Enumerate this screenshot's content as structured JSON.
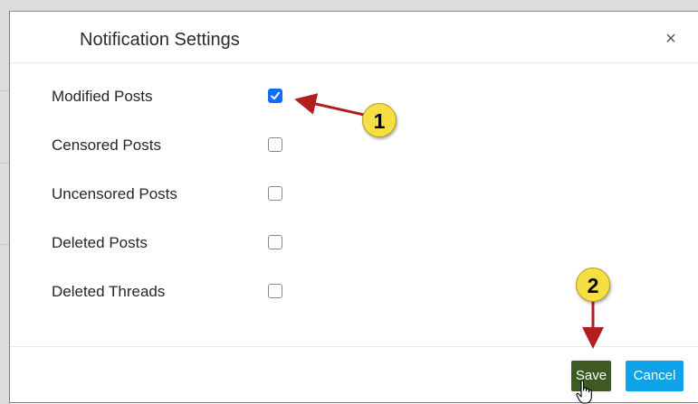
{
  "dialog": {
    "title": "Notification Settings",
    "close_label": "×"
  },
  "options": [
    {
      "label": "Modified Posts",
      "checked": true
    },
    {
      "label": "Censored Posts",
      "checked": false
    },
    {
      "label": "Uncensored Posts",
      "checked": false
    },
    {
      "label": "Deleted Posts",
      "checked": false
    },
    {
      "label": "Deleted Threads",
      "checked": false
    }
  ],
  "footer": {
    "save_label": "Save",
    "cancel_label": "Cancel"
  },
  "annotations": {
    "step1": "1",
    "step2": "2"
  },
  "colors": {
    "checkbox_checked": "#0d6efd",
    "save_button": "#3d5a23",
    "cancel_button": "#0ea2e8",
    "annotation_badge": "#f8de45",
    "annotation_arrow": "#b01e1e"
  }
}
